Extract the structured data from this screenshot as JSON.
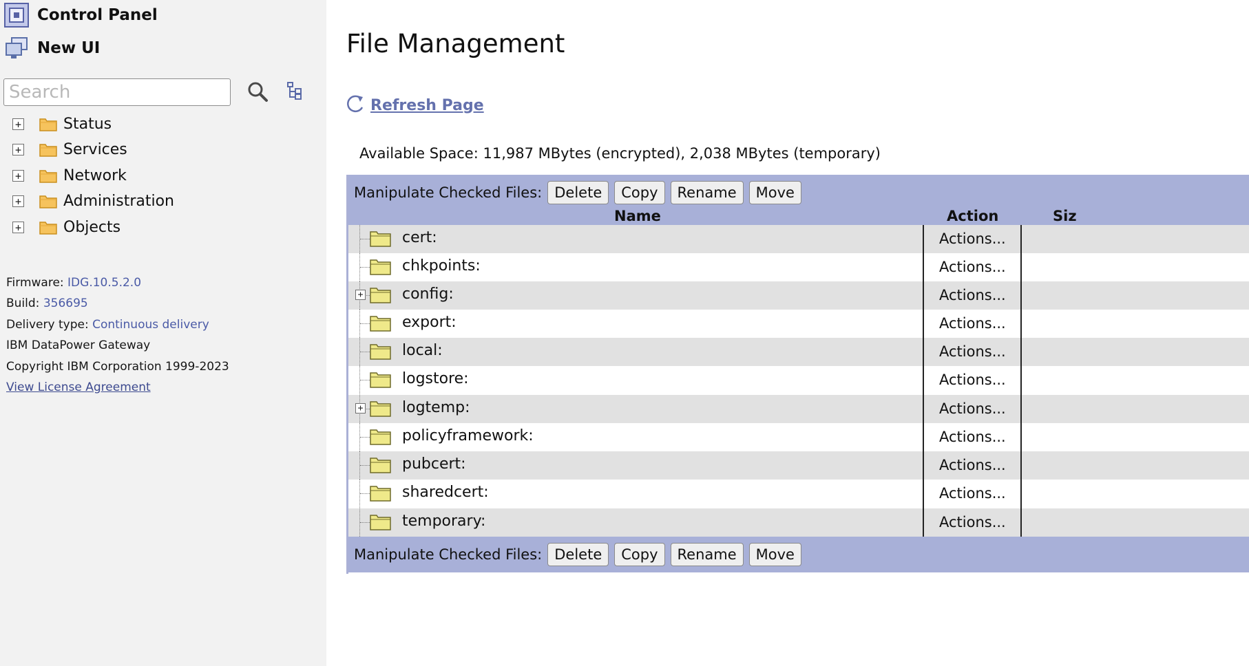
{
  "sidebar": {
    "control_panel": "Control Panel",
    "new_ui": "New UI",
    "search_placeholder": "Search",
    "tree": [
      {
        "label": "Status"
      },
      {
        "label": "Services"
      },
      {
        "label": "Network"
      },
      {
        "label": "Administration"
      },
      {
        "label": "Objects"
      }
    ],
    "expand_symbol": "+",
    "info": {
      "firmware_label": "Firmware:",
      "firmware_value": "IDG.10.5.2.0",
      "build_label": "Build:",
      "build_value": "356695",
      "delivery_label": "Delivery type:",
      "delivery_value": "Continuous delivery",
      "product": "IBM DataPower Gateway",
      "copyright": "Copyright IBM Corporation 1999-2023",
      "license_link": "View License Agreement"
    }
  },
  "main": {
    "title": "File Management",
    "refresh_label": "Refresh Page",
    "available_space": "Available Space: 11,987 MBytes (encrypted), 2,038 MBytes (temporary)",
    "manipulate_label": "Manipulate Checked Files:",
    "buttons": {
      "delete": "Delete",
      "copy": "Copy",
      "rename": "Rename",
      "move": "Move"
    },
    "columns": {
      "name": "Name",
      "action": "Action",
      "size": "Siz"
    },
    "action_label": "Actions...",
    "files": [
      {
        "name": "cert:",
        "expandable": false
      },
      {
        "name": "chkpoints:",
        "expandable": false
      },
      {
        "name": "config:",
        "expandable": true
      },
      {
        "name": "export:",
        "expandable": false
      },
      {
        "name": "local:",
        "expandable": false
      },
      {
        "name": "logstore:",
        "expandable": false
      },
      {
        "name": "logtemp:",
        "expandable": true
      },
      {
        "name": "policyframework:",
        "expandable": false
      },
      {
        "name": "pubcert:",
        "expandable": false
      },
      {
        "name": "sharedcert:",
        "expandable": false
      },
      {
        "name": "temporary:",
        "expandable": false
      }
    ]
  },
  "colors": {
    "sidebar_bg": "#f2f2f2",
    "table_header_bg": "#a8b0d8",
    "row_alt_bg": "#e1e1e1",
    "link_blue": "#6471ad",
    "sidebar_folder": "#f6c35d",
    "table_folder": "#efe98a"
  },
  "icons": {
    "control_panel": "control-panel-icon",
    "new_ui": "new-ui-icon",
    "search": "search-icon",
    "tree_view": "tree-view-icon",
    "folder": "folder-icon",
    "refresh": "refresh-icon"
  }
}
